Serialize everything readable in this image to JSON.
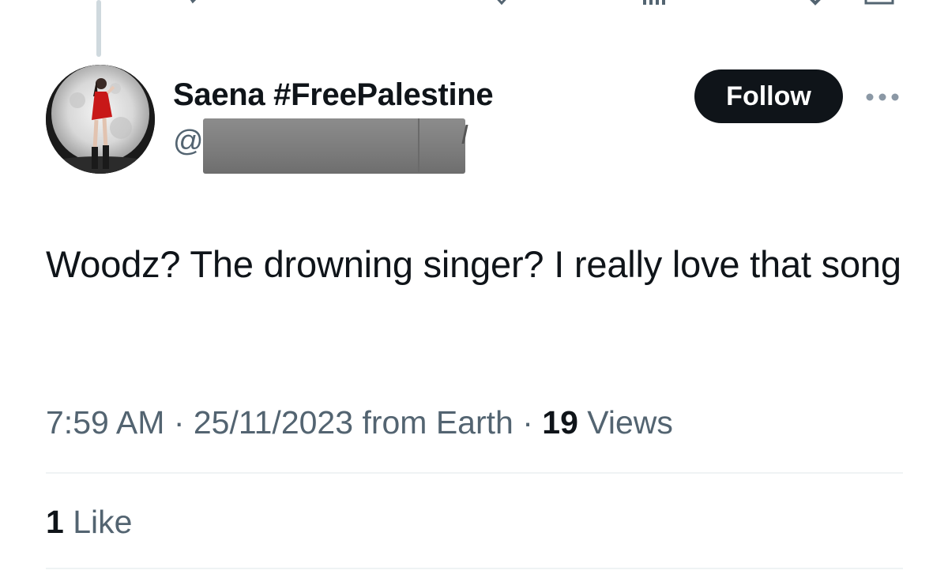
{
  "author": {
    "display_name": "Saena #FreePalestine",
    "handle_prefix": "@",
    "follow_label": "Follow"
  },
  "tweet": {
    "text": "Woodz? The drowning singer? I really love that song",
    "time": "7:59 AM",
    "separator": " · ",
    "date": "25/11/2023",
    "source": " from Earth",
    "views_count": "19",
    "views_label": " Views"
  },
  "engagement": {
    "likes_count": "1",
    "likes_label": " Like"
  },
  "icons": {
    "more": "more-horizontal-icon",
    "avatar": "avatar-image"
  },
  "colors": {
    "text_primary": "#0f1419",
    "text_secondary": "#536471",
    "follow_bg": "#0f1419",
    "divider": "#eff3f4",
    "redaction": "#7b7b7b"
  }
}
